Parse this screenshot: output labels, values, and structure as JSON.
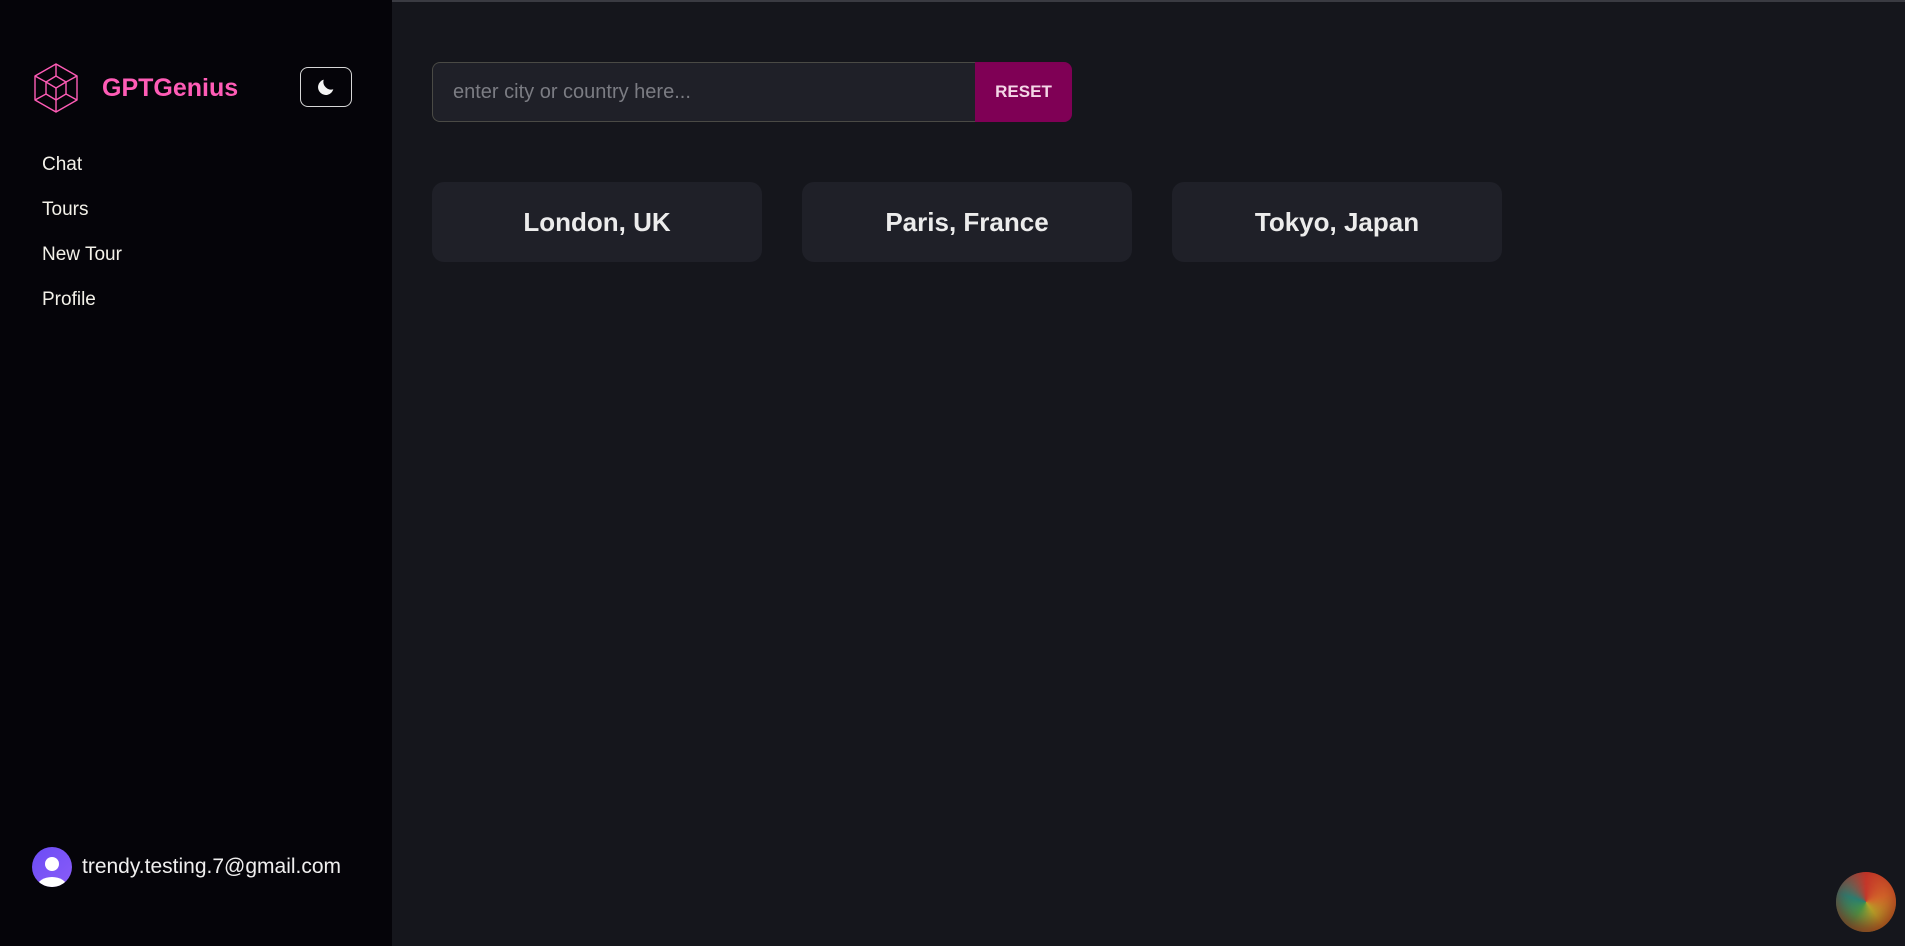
{
  "app": {
    "name": "GPTGenius"
  },
  "sidebar": {
    "nav": [
      {
        "label": "Chat"
      },
      {
        "label": "Tours"
      },
      {
        "label": "New Tour"
      },
      {
        "label": "Profile"
      }
    ],
    "user": {
      "email": "trendy.testing.7@gmail.com"
    }
  },
  "search": {
    "placeholder": "enter city or country here...",
    "value": "",
    "reset_label": "RESET"
  },
  "tours": [
    {
      "label": "London, UK"
    },
    {
      "label": "Paris, France"
    },
    {
      "label": "Tokyo, Japan"
    }
  ],
  "colors": {
    "accent": "#ff5cb6",
    "reset_button": "#7f0055",
    "sidebar_bg": "#050409",
    "main_bg": "#15161c",
    "card_bg": "#1f2028"
  },
  "icons": {
    "logo": "hexagon-cubes-logo-icon",
    "theme_toggle": "moon-icon",
    "avatar": "user-avatar-icon"
  }
}
